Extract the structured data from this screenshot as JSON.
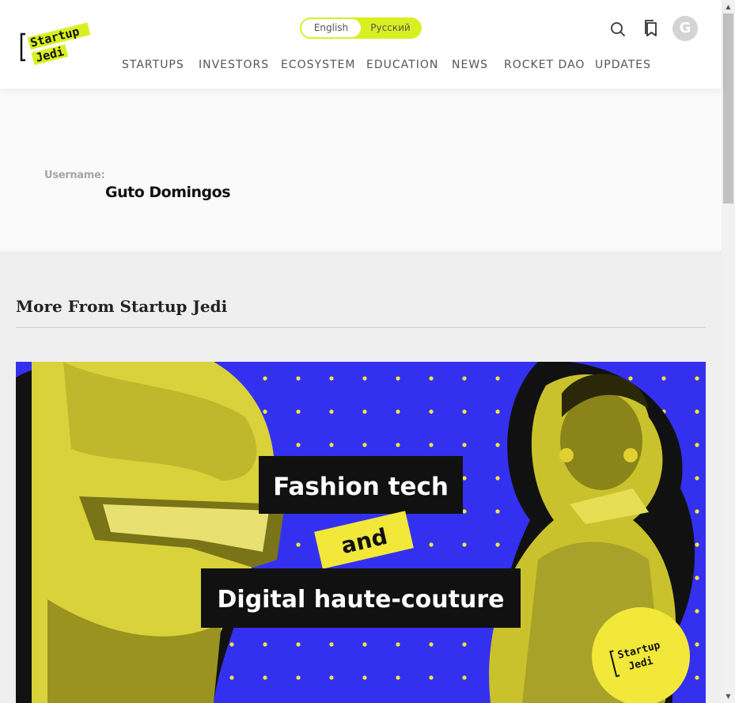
{
  "header": {
    "logo_line1": "Startup",
    "logo_line2": "Jedi",
    "lang": {
      "english": "English",
      "russian": "Русский"
    },
    "avatar_letter": "G",
    "nav": [
      "STARTUPS",
      "INVESTORS",
      "ECOSYSTEM",
      "EDUCATION",
      "NEWS",
      "ROCKET DAO",
      "UPDATES"
    ]
  },
  "profile": {
    "username_label": "Username:",
    "username": "Guto Domingos"
  },
  "more": {
    "title": "More From Startup Jedi",
    "card": {
      "line1": "Fashion tech",
      "line2": "and",
      "line3": "Digital haute-couture",
      "badge_line1": "Startup",
      "badge_line2": "Jedi"
    }
  },
  "colors": {
    "accent_yellow": "#d8f022",
    "card_blue": "#3430f0",
    "card_yellow": "#f2e83a"
  }
}
